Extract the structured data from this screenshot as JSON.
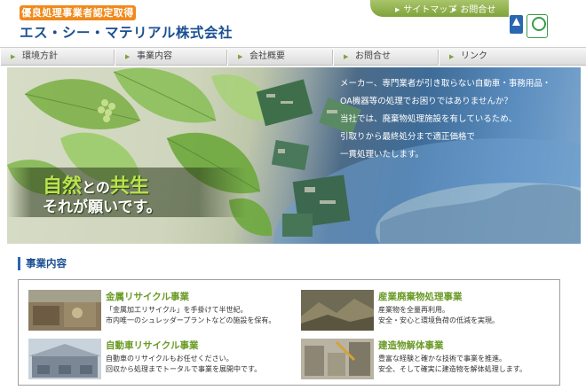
{
  "header": {
    "badge": "優良処理事業者認定取得",
    "company_name": "エス・シー・マテリアル株式会社",
    "top_links": [
      {
        "label": "サイトマップ"
      },
      {
        "label": "お問合せ"
      }
    ]
  },
  "nav": {
    "items": [
      {
        "label": "環境方針"
      },
      {
        "label": "事業内容"
      },
      {
        "label": "会社概要"
      },
      {
        "label": "お問合せ"
      },
      {
        "label": "リンク"
      }
    ]
  },
  "hero": {
    "lines": [
      "メーカー、専門業者が引き取らない自動車・事務用品・",
      "OA機器等の処理でお困りではありませんか？",
      "当社では、廃棄物処理施設を有しているため、",
      "引取りから最終処分まで適正価格で",
      "一貫処理いたします。"
    ],
    "slogan_a": "自然",
    "slogan_b": "との",
    "slogan_c": "共生",
    "slogan_line2": "それが願いです。"
  },
  "business": {
    "title": "事業内容",
    "items": [
      {
        "title": "金属リサイクル事業",
        "desc": [
          "「金属加工リサイクル」を手掛けて半世紀。",
          "市内唯一のシュレッダープラントなどの施設を保有。"
        ]
      },
      {
        "title": "産業廃棄物処理事業",
        "desc": [
          "産業物を全量再利用。",
          "安全・安心と環境負荷の低減を実現。"
        ]
      },
      {
        "title": "自動車リサイクル事業",
        "desc": [
          "自動車のリサイクルもお任せください。",
          "回収から処理までトータルで事業を展開中です。"
        ]
      },
      {
        "title": "建造物解体事業",
        "desc": [
          "豊富な経験と確かな技術で事業を推進。",
          "安全、そして確実に建造物を解体処理します。"
        ]
      }
    ]
  },
  "colors": {
    "brand_blue": "#1a4f92",
    "accent_green": "#6a9a26",
    "badge_orange": "#f08a1c"
  }
}
